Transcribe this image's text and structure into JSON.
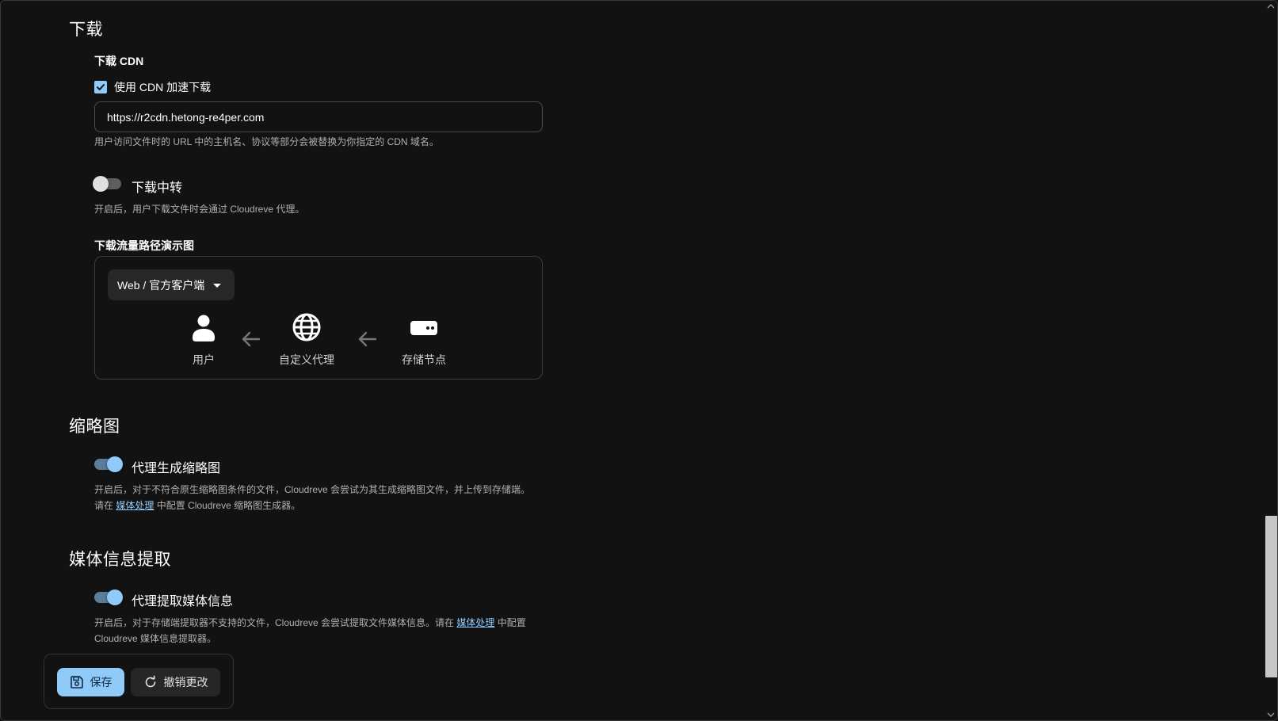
{
  "download": {
    "section_title": "下载",
    "cdn": {
      "label": "下载 CDN",
      "checkbox_label": "使用 CDN 加速下载",
      "checked": true,
      "url_value": "https://r2cdn.hetong-re4per.com",
      "helper": "用户访问文件时的 URL 中的主机名、协议等部分会被替换为你指定的 CDN 域名。"
    },
    "relay": {
      "label": "下载中转",
      "enabled": false,
      "helper": "开启后，用户下载文件时会通过 Cloudreve 代理。"
    },
    "diagram": {
      "label": "下载流量路径演示图",
      "client_select": "Web / 官方客户端",
      "nodes": [
        {
          "name": "用户",
          "icon": "user-icon"
        },
        {
          "name": "自定义代理",
          "icon": "globe-icon"
        },
        {
          "name": "存储节点",
          "icon": "storage-node-icon"
        }
      ]
    }
  },
  "thumbnail": {
    "section_title": "缩略图",
    "switch_label": "代理生成缩略图",
    "enabled": true,
    "helper_before_link": "开启后，对于不符合原生缩略图条件的文件，Cloudreve 会尝试为其生成缩略图文件，并上传到存储端。请在",
    "helper_link": "媒体处理",
    "helper_after_link": "中配置 Cloudreve 缩略图生成器。"
  },
  "media": {
    "section_title": "媒体信息提取",
    "switch_label": "代理提取媒体信息",
    "enabled": true,
    "helper_before_link": "开启后，对于存储端提取器不支持的文件，Cloudreve 会尝试提取文件媒体信息。请在",
    "helper_link": "媒体处理",
    "helper_after_link": "中配置 Cloudreve 媒体信息提取器。"
  },
  "actions": {
    "save_label": "保存",
    "revert_label": "撤销更改"
  },
  "colors": {
    "accent": "#90caf9",
    "background": "#121212",
    "link": "#90caf9"
  }
}
